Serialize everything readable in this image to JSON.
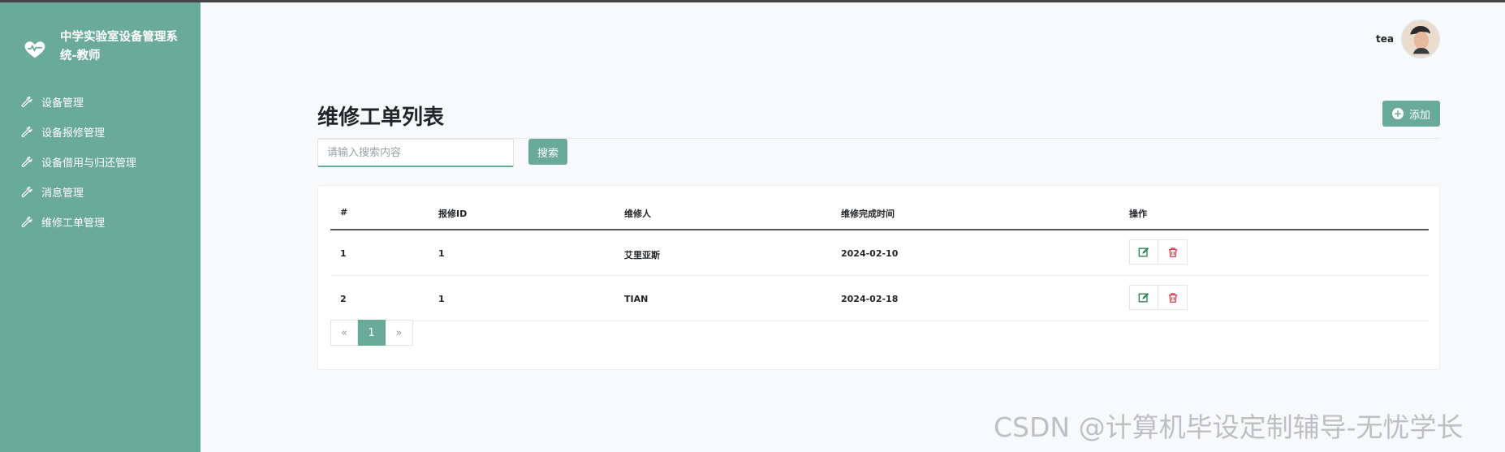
{
  "sidebar": {
    "brand": "中学实验室设备管理系统-教师",
    "items": [
      {
        "label": "设备管理",
        "icon": "wrench-icon"
      },
      {
        "label": "设备报修管理",
        "icon": "wrench-icon"
      },
      {
        "label": "设备借用与归还管理",
        "icon": "wrench-icon"
      },
      {
        "label": "消息管理",
        "icon": "wrench-icon"
      },
      {
        "label": "维修工单管理",
        "icon": "wrench-icon"
      }
    ]
  },
  "header": {
    "username": "tea"
  },
  "main": {
    "title": "维修工单列表",
    "add_label": "添加",
    "search": {
      "placeholder": "请输入搜索内容",
      "value": "",
      "button": "搜索"
    },
    "table": {
      "headers": [
        "#",
        "报修ID",
        "维修人",
        "维修完成时间",
        "操作"
      ],
      "rows": [
        [
          "1",
          "1",
          "艾里亚斯",
          "2024-02-10"
        ],
        [
          "2",
          "1",
          "TIAN",
          "2024-02-18"
        ]
      ]
    },
    "pagination": {
      "prev": "«",
      "current": "1",
      "next": "»"
    }
  },
  "watermark": "CSDN @计算机毕设定制辅导-无忧学长",
  "colors": {
    "accent": "#6aaa98",
    "edit": "#2e8b57",
    "delete": "#dc3545"
  }
}
